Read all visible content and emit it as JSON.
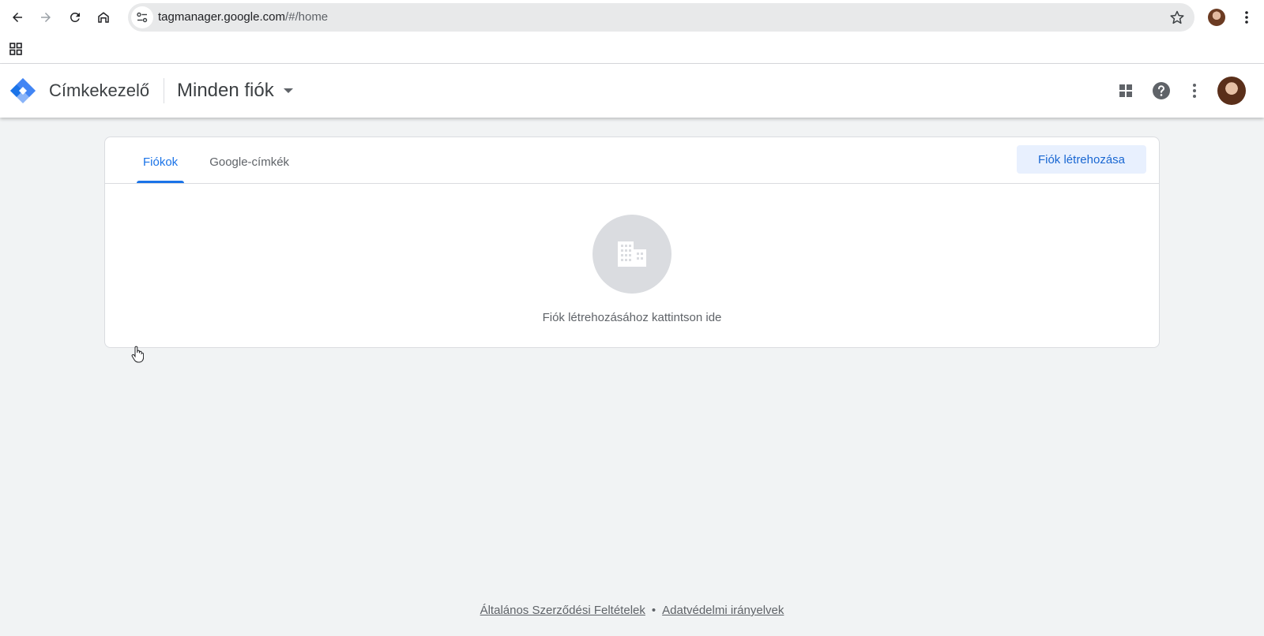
{
  "browser": {
    "url_host": "tagmanager.google.com",
    "url_path": "/#/home",
    "icons": {
      "back": "arrow-left-icon",
      "forward": "arrow-right-icon",
      "reload": "reload-icon",
      "home": "home-icon",
      "site_info": "tune-icon",
      "bookmark": "star-icon",
      "menu": "more-vert-icon",
      "apps": "apps-grid-icon"
    }
  },
  "header": {
    "product_name": "Címkekezelő",
    "account_switcher_label": "Minden fiók",
    "icons": [
      "apps-icon",
      "help-icon",
      "more-vert-icon"
    ]
  },
  "card": {
    "tabs": [
      {
        "label": "Fiókok",
        "active": true
      },
      {
        "label": "Google-címkék",
        "active": false
      }
    ],
    "create_button_label": "Fiók létrehozása",
    "empty_state_text": "Fiók létrehozásához kattintson ide"
  },
  "footer": {
    "terms_link": "Általános Szerződési Feltételek",
    "separator": "•",
    "privacy_link": "Adatvédelmi irányelvek"
  },
  "colors": {
    "accent": "#1a73e8",
    "button_bg": "#e8f0fe",
    "page_bg": "#f1f3f4"
  }
}
